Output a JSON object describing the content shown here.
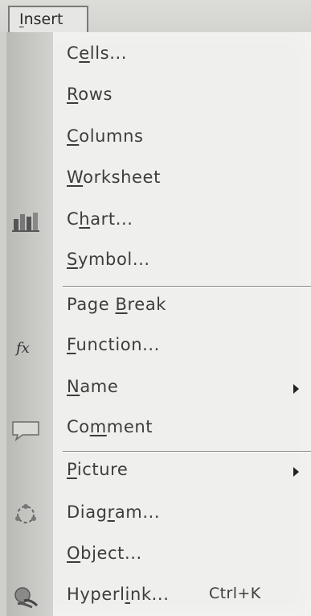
{
  "menu": {
    "title": "Insert",
    "title_mnemonic": "I",
    "title_rest": "nsert"
  },
  "items": [
    {
      "id": "cells",
      "pre": "C",
      "ul": "e",
      "post": "lls...",
      "has_submenu": false,
      "icon": ""
    },
    {
      "id": "rows",
      "pre": "",
      "ul": "R",
      "post": "ows",
      "has_submenu": false,
      "icon": ""
    },
    {
      "id": "columns",
      "pre": "",
      "ul": "C",
      "post": "olumns",
      "has_submenu": false,
      "icon": ""
    },
    {
      "id": "worksheet",
      "pre": "",
      "ul": "W",
      "post": "orksheet",
      "has_submenu": false,
      "icon": ""
    },
    {
      "id": "chart",
      "pre": "C",
      "ul": "h",
      "post": "art...",
      "has_submenu": false,
      "icon": "chart-icon"
    },
    {
      "id": "symbol",
      "pre": "",
      "ul": "S",
      "post": "ymbol...",
      "has_submenu": false,
      "icon": ""
    },
    {
      "id": "page-break",
      "pre": "Page ",
      "ul": "B",
      "post": "reak",
      "has_submenu": false,
      "icon": ""
    },
    {
      "id": "function",
      "pre": "",
      "ul": "F",
      "post": "unction...",
      "has_submenu": false,
      "icon": "function-icon"
    },
    {
      "id": "name",
      "pre": "",
      "ul": "N",
      "post": "ame",
      "has_submenu": true,
      "icon": ""
    },
    {
      "id": "comment",
      "pre": "Co",
      "ul": "m",
      "post": "ment",
      "has_submenu": false,
      "icon": "comment-icon"
    },
    {
      "id": "picture",
      "pre": "",
      "ul": "P",
      "post": "icture",
      "has_submenu": true,
      "icon": ""
    },
    {
      "id": "diagram",
      "pre": "Diag",
      "ul": "r",
      "post": "am...",
      "has_submenu": false,
      "icon": "diagram-icon"
    },
    {
      "id": "object",
      "pre": "",
      "ul": "O",
      "post": "bject...",
      "has_submenu": false,
      "icon": ""
    },
    {
      "id": "hyperlink",
      "pre": "Hyperl",
      "ul": "i",
      "post": "nk...",
      "has_submenu": false,
      "icon": "hyperlink-icon",
      "shortcut": "Ctrl+K"
    }
  ],
  "colors": {
    "menu_bg": "#efefed",
    "icon_strip": "#c2c2bf",
    "text": "#3d3d3d"
  }
}
